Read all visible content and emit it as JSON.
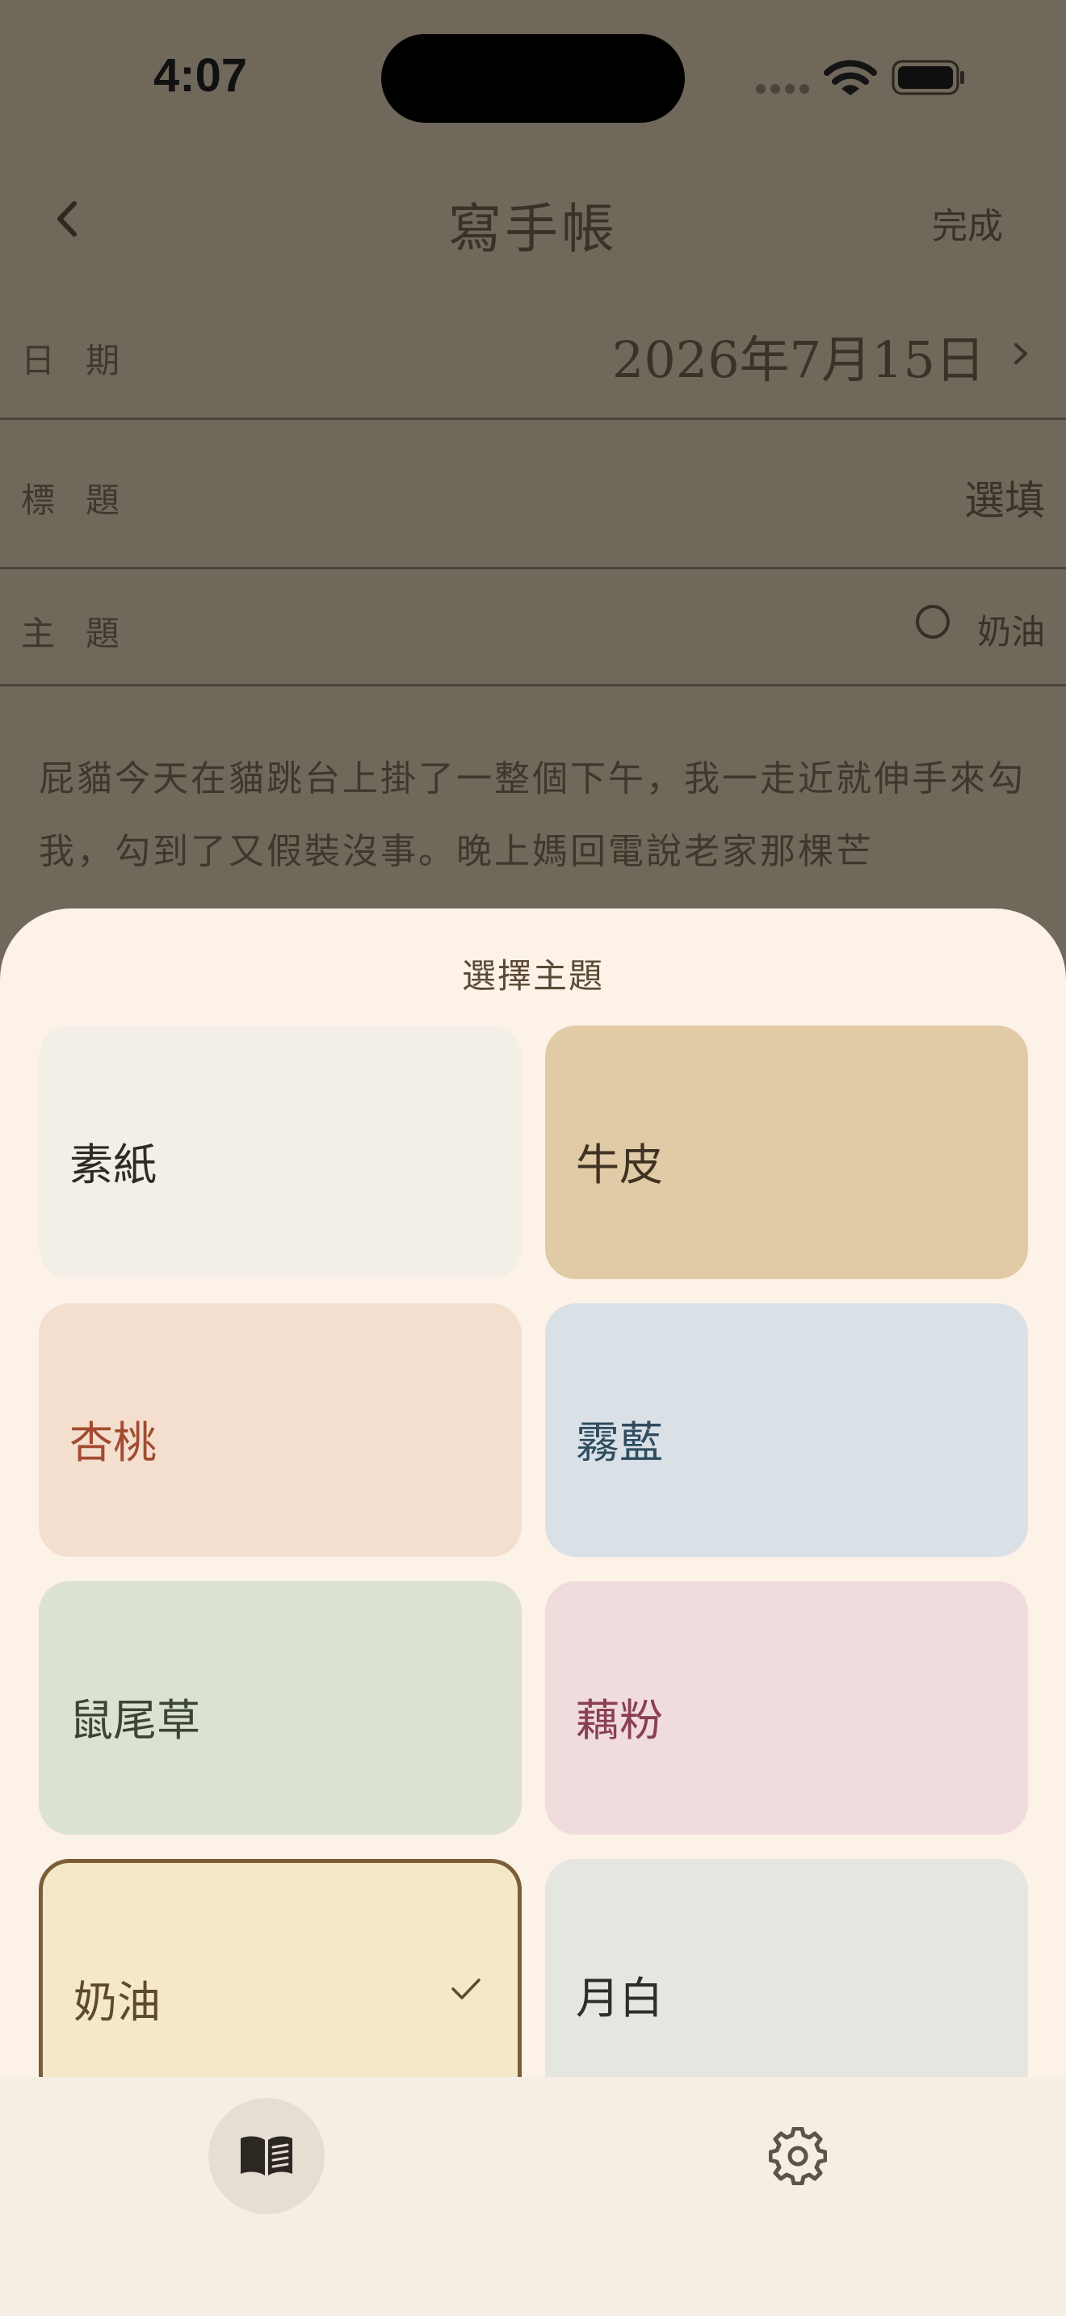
{
  "status_bar": {
    "time": "4:07"
  },
  "nav": {
    "title": "寫手帳",
    "done_label": "完成"
  },
  "form": {
    "date": {
      "label": "日期",
      "value": "2026年7月15日"
    },
    "title": {
      "label": "標題",
      "placeholder": "選填"
    },
    "theme": {
      "label": "主題",
      "value": "奶油"
    }
  },
  "body_text": "屁貓今天在貓跳台上掛了一整個下午，我一走近就伸手來勾我，勾到了又假裝沒事。晚上媽回電說老家那棵芒",
  "sheet": {
    "title": "選擇主題",
    "themes": [
      {
        "label": "素紙",
        "bg": "#f4efe6",
        "fg": "#2f2a22"
      },
      {
        "label": "牛皮",
        "bg": "#e1cba6",
        "fg": "#3f3322"
      },
      {
        "label": "杏桃",
        "bg": "#f4dfcf",
        "fg": "#a24b30"
      },
      {
        "label": "霧藍",
        "bg": "#d9e1e7",
        "fg": "#2f4c60"
      },
      {
        "label": "鼠尾草",
        "bg": "#dbe2d4",
        "fg": "#3a4534"
      },
      {
        "label": "藕粉",
        "bg": "#f0dcdc",
        "fg": "#8a4052"
      },
      {
        "label": "奶油",
        "bg": "#f5e8c8",
        "fg": "#5e4a2e",
        "selected": true
      },
      {
        "label": "月白",
        "bg": "#e6e6e1",
        "fg": "#2d2d2a"
      }
    ]
  },
  "colors": {
    "accent": "#7b5d38",
    "sheet_bg": "#fdf2e8",
    "scrim": "#6f685b"
  },
  "tabbar": {
    "icons": [
      "book-icon",
      "gear-icon"
    ]
  }
}
